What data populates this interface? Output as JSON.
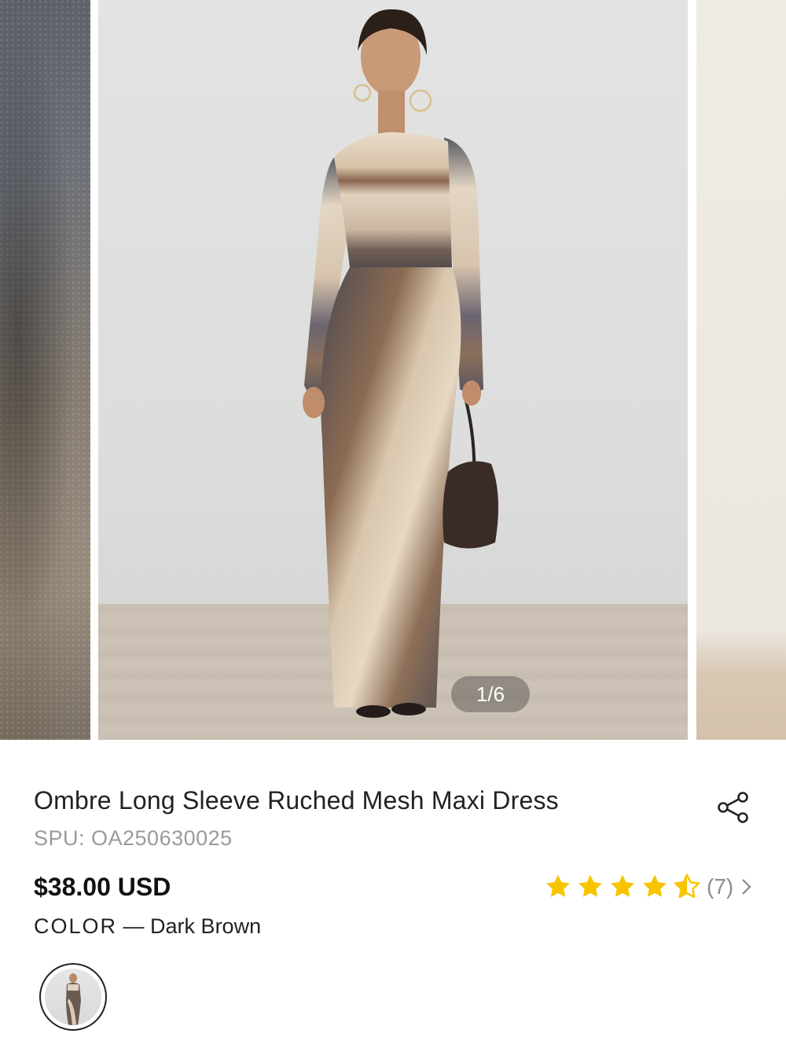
{
  "gallery": {
    "counter": "1/6",
    "images": [
      "fabric-closeup",
      "ombre-maxi-dress-model",
      "next-image"
    ]
  },
  "product": {
    "title": "Ombre Long Sleeve Ruched Mesh Maxi Dress",
    "spu": "SPU: OA250630025",
    "price": "$38.00 USD",
    "rating": 4.5,
    "rating_max": 5,
    "review_count": "(7)",
    "color_label": "COLOR",
    "color_separator": " — ",
    "color_value": "Dark Brown"
  },
  "colors": {
    "star": "#F7C500",
    "text": "#222222",
    "muted": "#9A9A9A"
  },
  "icons": {
    "share": "share-icon",
    "star": "star-icon",
    "half_star": "star-half-icon",
    "chevron": "chevron-right-icon"
  }
}
